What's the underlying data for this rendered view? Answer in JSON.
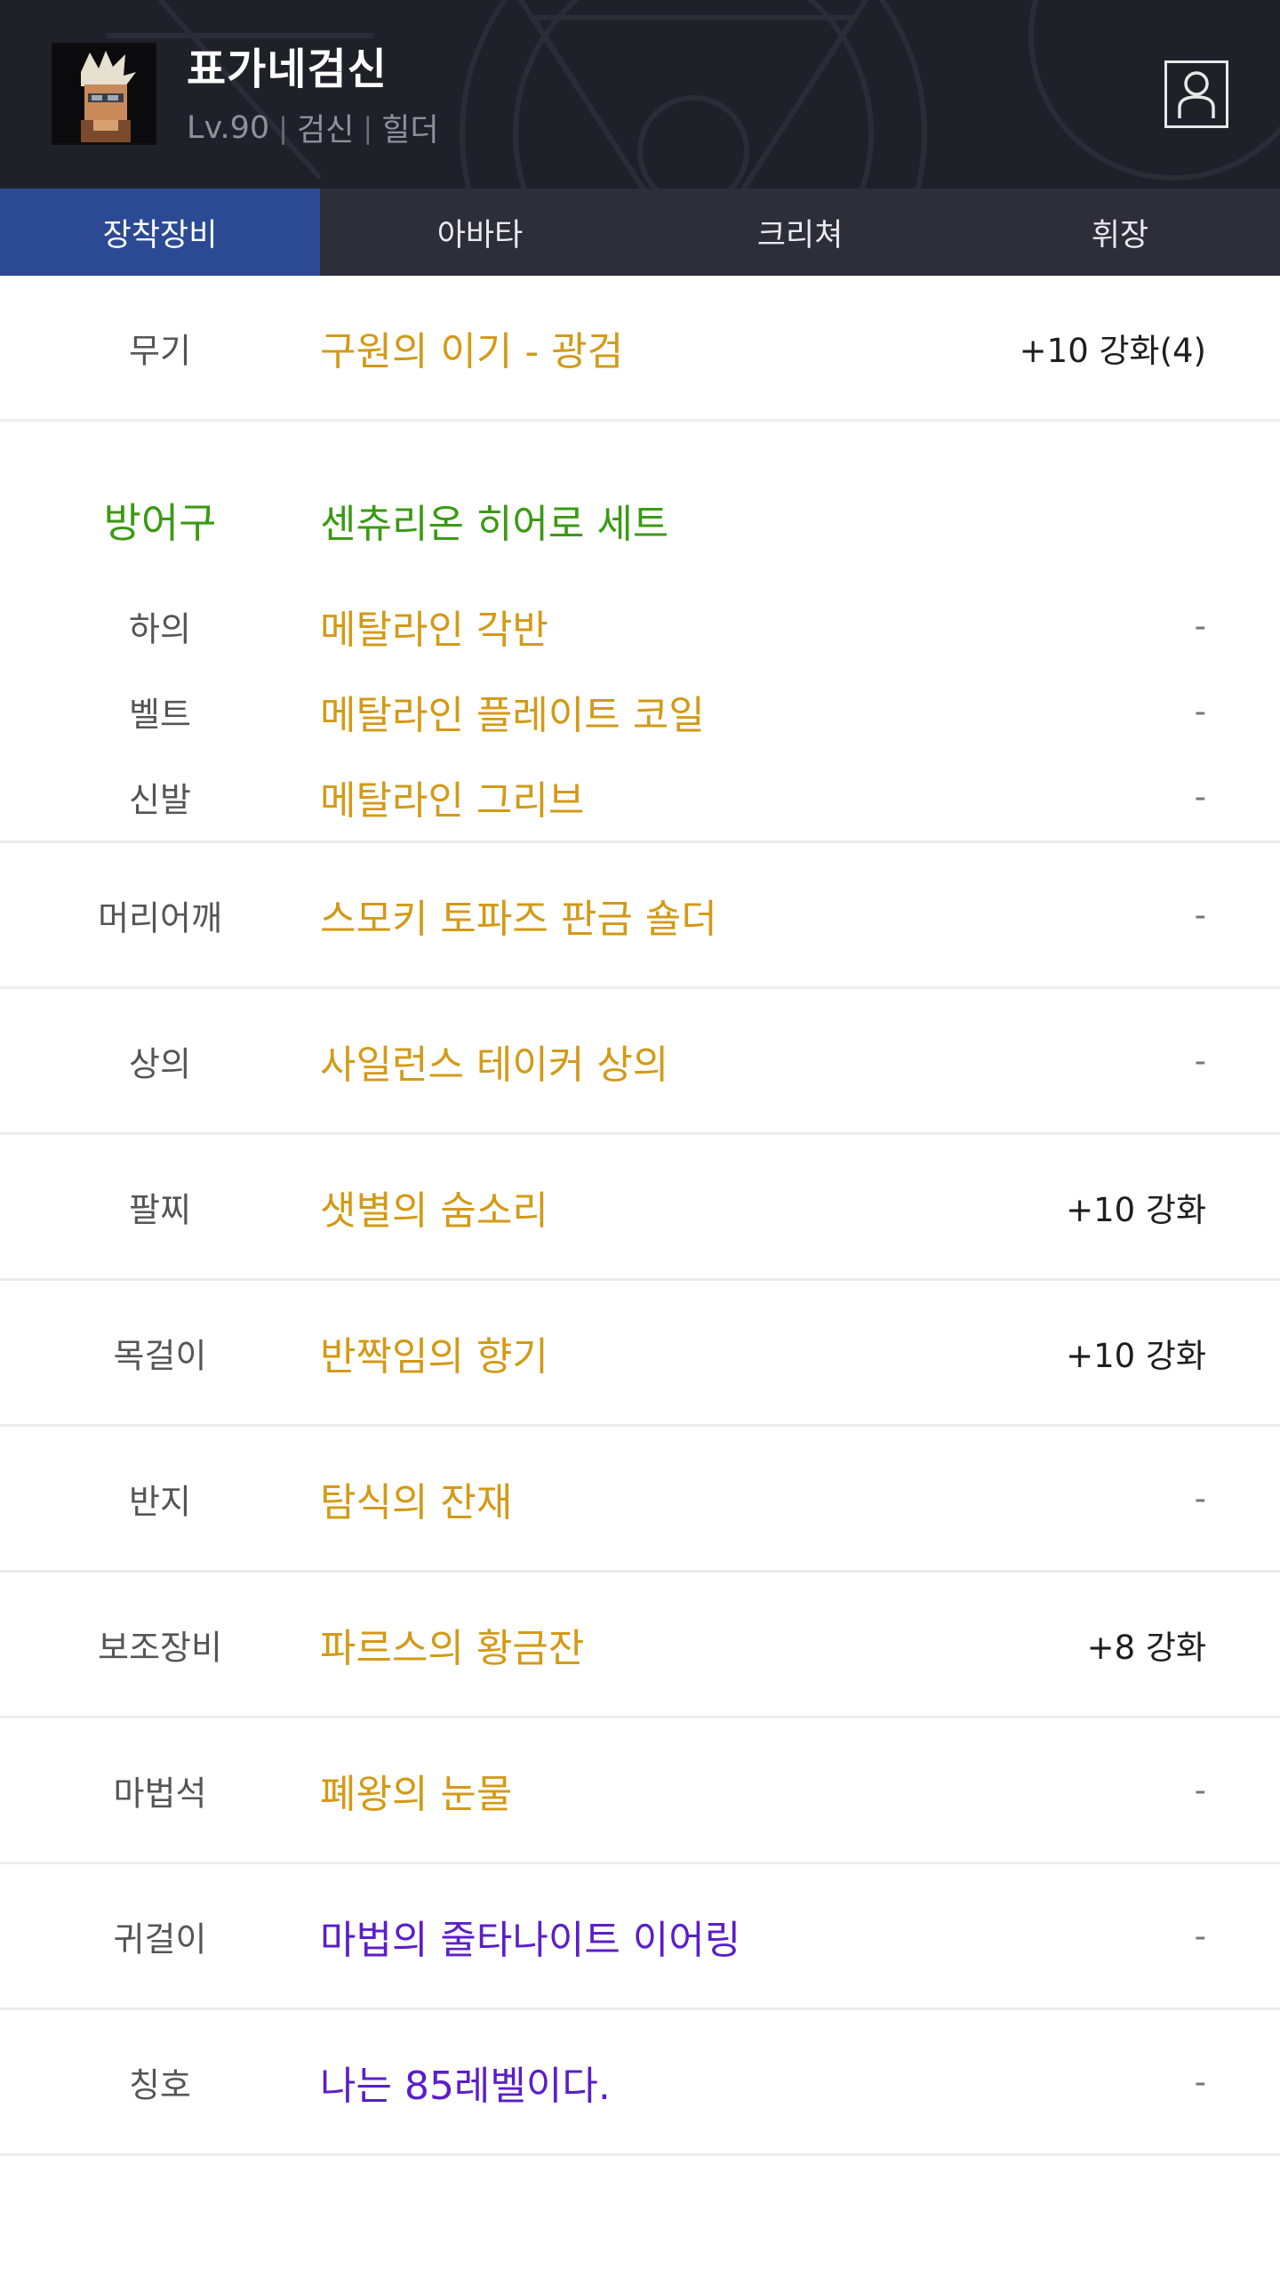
{
  "header": {
    "character_name": "표가네검신",
    "level": "Lv.90",
    "job": "검신",
    "guild": "힐더",
    "separator": "|",
    "profile_icon": "person-icon"
  },
  "tabs": [
    {
      "label": "장착장비",
      "active": true
    },
    {
      "label": "아바타",
      "active": false
    },
    {
      "label": "크리쳐",
      "active": false
    },
    {
      "label": "휘장",
      "active": false
    }
  ],
  "equipment": {
    "weapon": {
      "slot": "무기",
      "item": "구원의 이기 - 광검",
      "enhance": "+10 강화(4)"
    },
    "armor": {
      "slot": "방어구",
      "set": "센츄리온 히어로 세트",
      "pieces": [
        {
          "slot": "하의",
          "item": "메탈라인 각반",
          "enhance": "-"
        },
        {
          "slot": "벨트",
          "item": "메탈라인 플레이트 코일",
          "enhance": "-"
        },
        {
          "slot": "신발",
          "item": "메탈라인 그리브",
          "enhance": "-"
        }
      ]
    },
    "rows": [
      {
        "slot": "머리어깨",
        "item": "스모키 토파즈 판금 숄더",
        "enhance": "-"
      },
      {
        "slot": "상의",
        "item": "사일런스 테이커 상의",
        "enhance": "-"
      },
      {
        "slot": "팔찌",
        "item": "샛별의 숨소리",
        "enhance": "+10 강화"
      },
      {
        "slot": "목걸이",
        "item": "반짝임의 향기",
        "enhance": "+10 강화"
      },
      {
        "slot": "반지",
        "item": "탐식의 잔재",
        "enhance": "-"
      },
      {
        "slot": "보조장비",
        "item": "파르스의 황금잔",
        "enhance": "+8 강화"
      },
      {
        "slot": "마법석",
        "item": "폐왕의 눈물",
        "enhance": "-"
      },
      {
        "slot": "귀걸이",
        "item": "마법의 줄타나이트 이어링",
        "enhance": "-"
      },
      {
        "slot": "칭호",
        "item": "나는 85레벨이다.",
        "enhance": "-"
      }
    ]
  },
  "colors": {
    "header_bg": "#1f2129",
    "tab_bg": "#2c2f39",
    "tab_active": "#2c4a94",
    "item_unique": "#d39a17",
    "item_set": "#3b9a14",
    "item_rare": "#5a1fc8"
  }
}
